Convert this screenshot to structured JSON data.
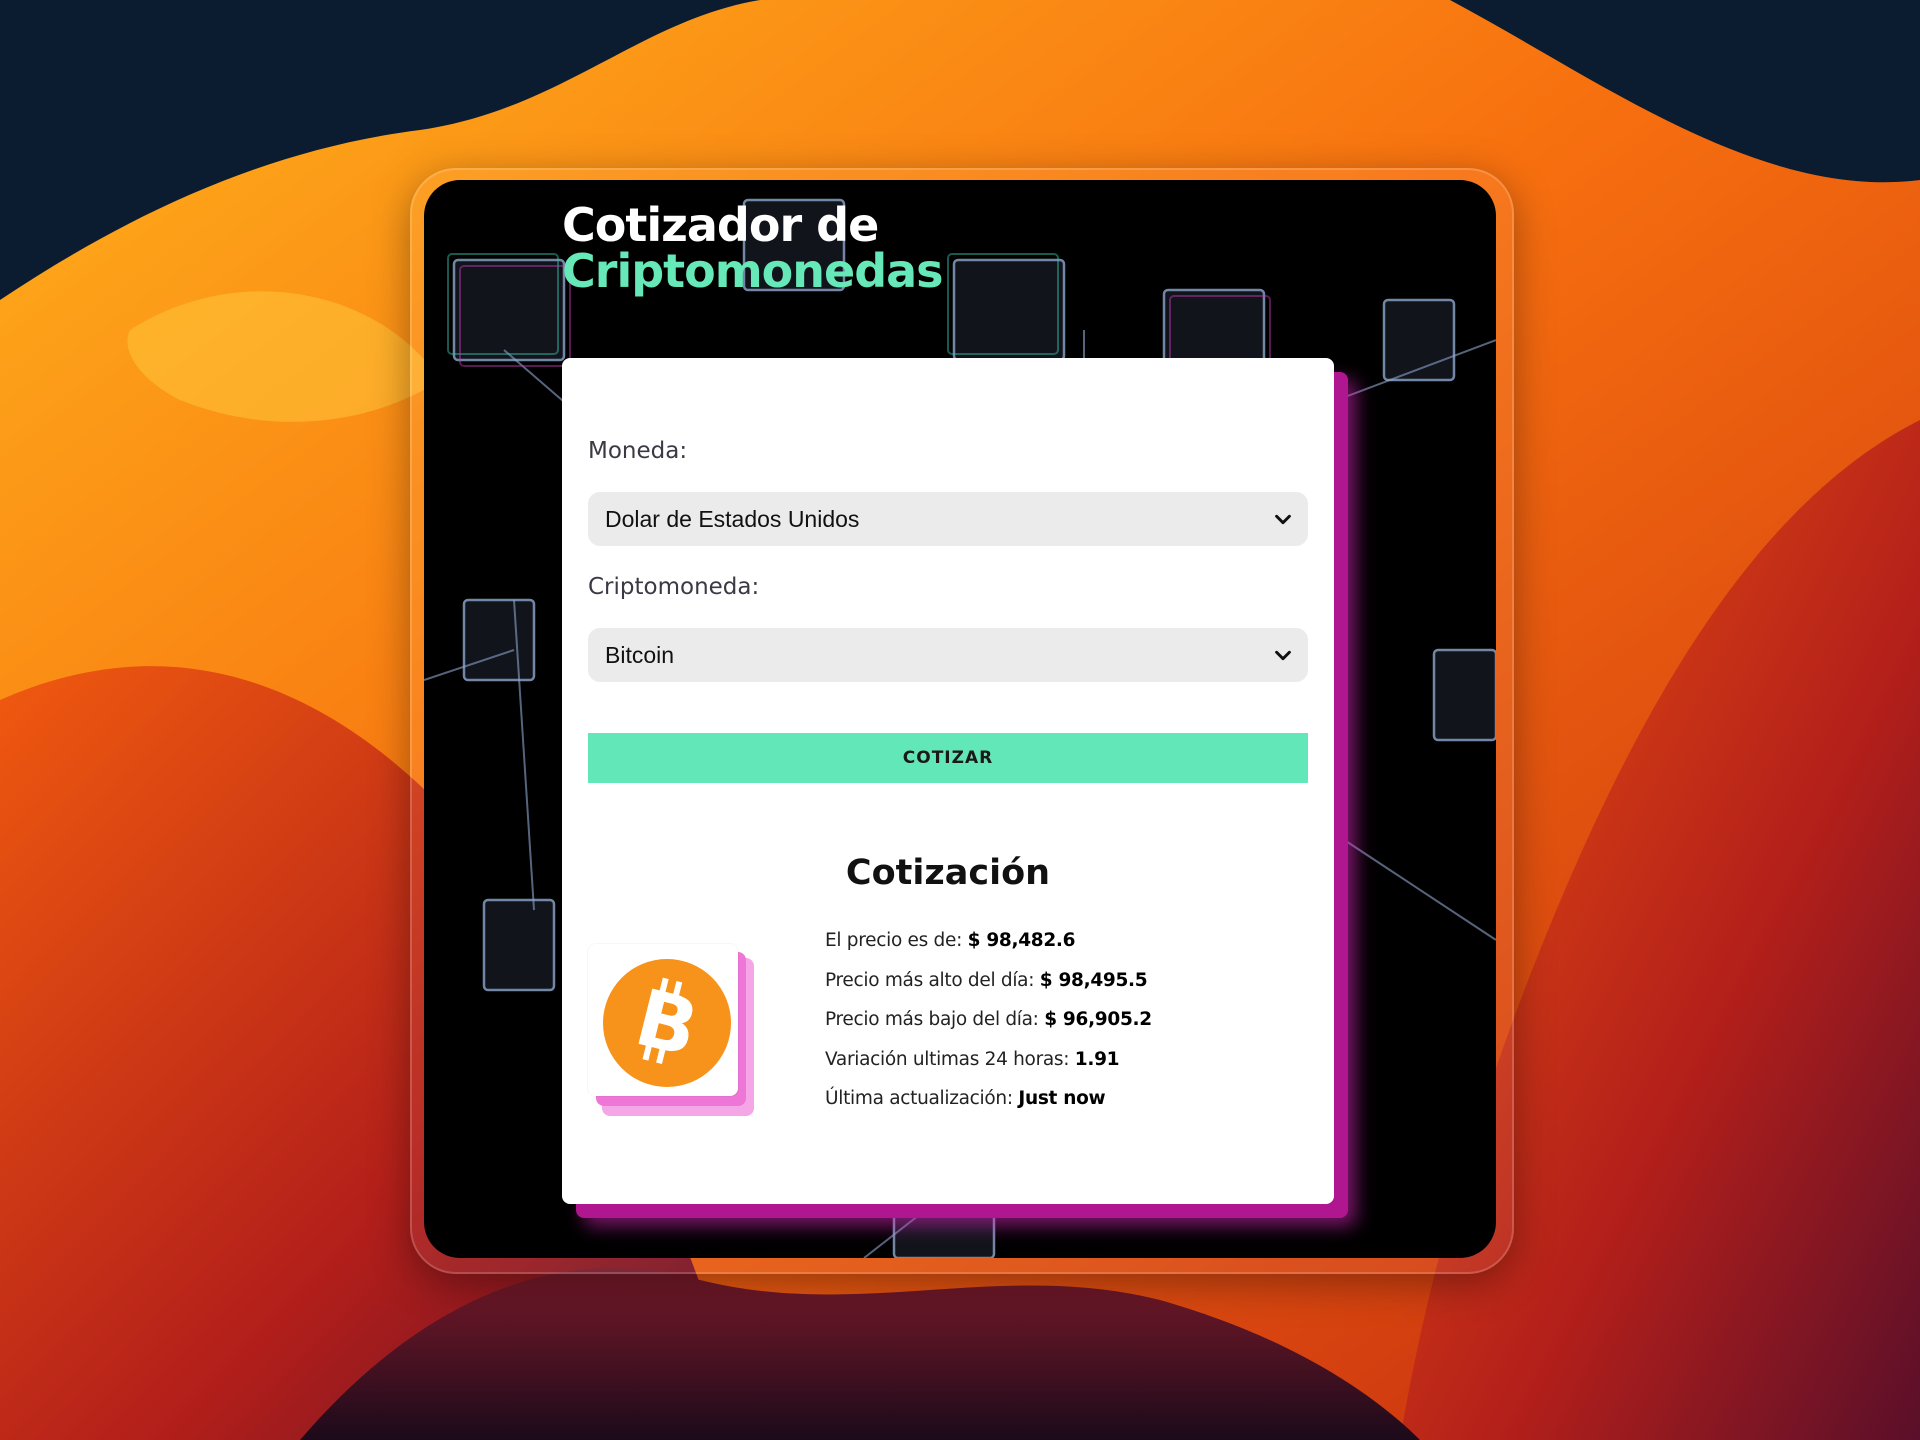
{
  "app": {
    "title_line1": "Cotizador de",
    "title_line2": "Criptomonedas"
  },
  "form": {
    "currency_label": "Moneda:",
    "currency_selected": "Dolar de Estados Unidos",
    "crypto_label": "Criptomoneda:",
    "crypto_selected": "Bitcoin",
    "submit_label": "COTIZAR"
  },
  "result": {
    "heading": "Cotización",
    "coin_icon": "bitcoin-icon",
    "rows": [
      {
        "label": "El precio es de:",
        "value": "$ 98,482.6"
      },
      {
        "label": "Precio más alto del día:",
        "value": "$ 98,495.5"
      },
      {
        "label": "Precio más bajo del día:",
        "value": "$ 96,905.2"
      },
      {
        "label": "Variación ultimas 24 horas:",
        "value": "1.91"
      },
      {
        "label": "Última actualización:",
        "value": "Just now"
      }
    ]
  },
  "colors": {
    "accent_green": "#62e8b8",
    "accent_magenta": "#b0168f",
    "bitcoin_orange": "#f7931a"
  }
}
